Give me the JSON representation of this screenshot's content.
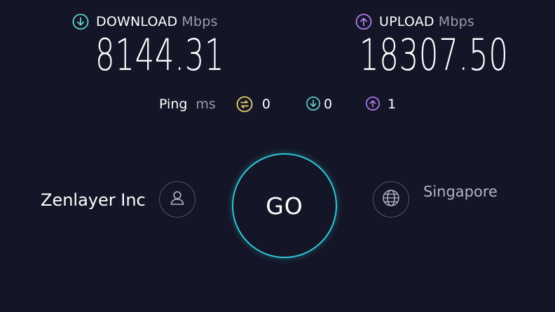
{
  "download": {
    "label": "DOWNLOAD",
    "unit": "Mbps",
    "value": "8144.31",
    "icon": "download-arrow-icon",
    "color": "#5fd2c8"
  },
  "upload": {
    "label": "UPLOAD",
    "unit": "Mbps",
    "value": "18307.50",
    "icon": "upload-arrow-icon",
    "color": "#b07cf0"
  },
  "ping": {
    "label": "Ping",
    "unit": "ms",
    "idle": {
      "value": "0",
      "icon": "idle-latency-icon",
      "color": "#e8d36a"
    },
    "download": {
      "value": "0",
      "icon": "download-latency-icon",
      "color": "#5fd2c8"
    },
    "upload": {
      "value": "1",
      "icon": "upload-latency-icon",
      "color": "#b07cf0"
    }
  },
  "provider": {
    "name": "Zenlayer Inc",
    "icon": "user-icon"
  },
  "server": {
    "name": "Singapore",
    "icon": "globe-icon"
  },
  "go_button": {
    "label": "GO",
    "color": "#2fc8d6"
  }
}
